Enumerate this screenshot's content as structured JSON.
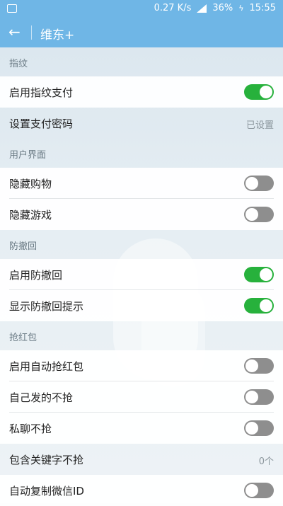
{
  "status_bar": {
    "speed": "0.27 K/s",
    "battery": "36%",
    "time": "15:55",
    "icons": [
      "image-icon",
      "signal-icon",
      "charging-icon"
    ]
  },
  "app_bar": {
    "title": "维东+",
    "back_icon": "arrow-left-icon"
  },
  "colors": {
    "accent": "#6fb6e6",
    "toggle_on": "#27b13c",
    "toggle_off": "#8e8e8e"
  },
  "sections": {
    "fingerprint": {
      "header": "指纹",
      "items": [
        {
          "label": "启用指纹支付",
          "toggle": true
        },
        {
          "label": "设置支付密码",
          "value": "已设置"
        }
      ]
    },
    "ui": {
      "header": "用户界面",
      "items": [
        {
          "label": "隐藏购物",
          "toggle": false
        },
        {
          "label": "隐藏游戏",
          "toggle": false
        }
      ]
    },
    "recall": {
      "header": "防撤回",
      "items": [
        {
          "label": "启用防撤回",
          "toggle": true
        },
        {
          "label": "显示防撤回提示",
          "toggle": true
        }
      ]
    },
    "redpacket": {
      "header": "抢红包",
      "items": [
        {
          "label": "启用自动抢红包",
          "toggle": false
        },
        {
          "label": "自己发的不抢",
          "toggle": false
        },
        {
          "label": "私聊不抢",
          "toggle": false
        },
        {
          "label": "包含关键字不抢",
          "value": "0个"
        },
        {
          "label": "自动复制微信ID",
          "toggle": false
        }
      ]
    }
  }
}
